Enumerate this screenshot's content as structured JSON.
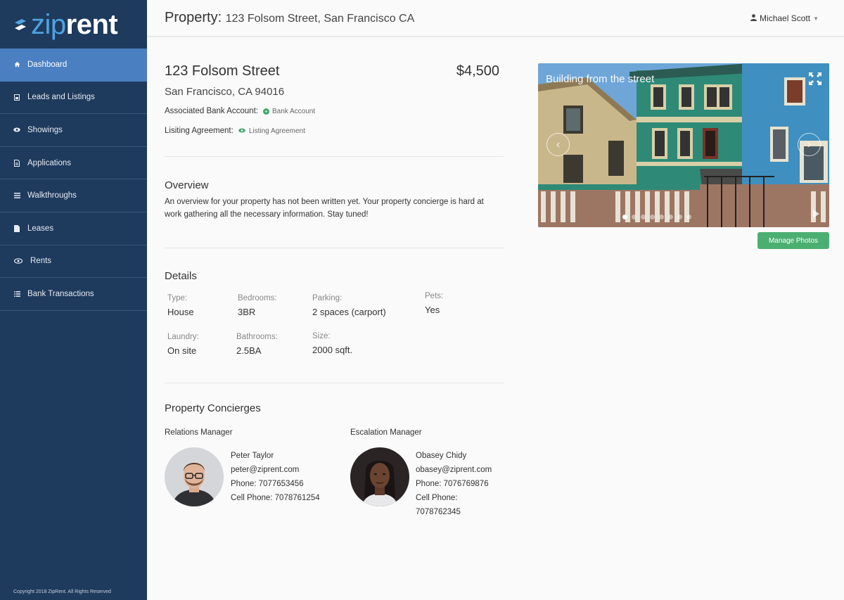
{
  "brand": {
    "zip": "zip",
    "rent": "rent"
  },
  "sidebar": {
    "items": [
      {
        "label": "Dashboard",
        "icon": "home-icon"
      },
      {
        "label": "Leads and Listings",
        "icon": "listing-icon"
      },
      {
        "label": "Showings",
        "icon": "eye-icon"
      },
      {
        "label": "Applications",
        "icon": "document-icon"
      },
      {
        "label": "Walkthroughs",
        "icon": "list-icon"
      },
      {
        "label": "Leases",
        "icon": "file-icon"
      },
      {
        "label": "Rents",
        "icon": "money-icon"
      },
      {
        "label": "Bank Transactions",
        "icon": "list-icon"
      }
    ],
    "copyright": "Copyright 2018 ZipRent. All Rights Reserved"
  },
  "header": {
    "title": "Property:",
    "address": "123 Folsom Street, San Francisco CA",
    "user": "Michael Scott"
  },
  "property": {
    "name": "123 Folsom Street",
    "price": "$4,500",
    "city": "San Francisco, CA 94016",
    "bank_label": "Associated Bank Account:",
    "bank_value": "Bank Account",
    "agreement_label": "Lisiting Agreement:",
    "agreement_value": "Listing Agreement"
  },
  "overview": {
    "title": "Overview",
    "text": "An overview for your property has not been written yet. Your property concierge is hard at work gathering all the necessary information. Stay tuned!"
  },
  "details": {
    "title": "Details",
    "type_label": "Type:",
    "type": "House",
    "bedrooms_label": "Bedrooms:",
    "bedrooms": "3BR",
    "parking_label": "Parking:",
    "parking": "2 spaces (carport)",
    "pets_label": "Pets:",
    "pets": "Yes",
    "laundry_label": "Laundry:",
    "laundry": "On site",
    "bathrooms_label": "Bathrooms:",
    "bathrooms": "2.5BA",
    "size_label": "Size:",
    "size": "2000 sqft."
  },
  "concierges": {
    "title": "Property Concierges",
    "relations": {
      "role": "Relations Manager",
      "name": "Peter Taylor",
      "email": "peter@ziprent.com",
      "phone": "Phone: 7077653456",
      "cell": "Cell Phone: 7078761254"
    },
    "escalation": {
      "role": "Escalation Manager",
      "name": "Obasey Chidy",
      "email": "obasey@ziprent.com",
      "phone": "Phone: 7076769876",
      "cell": "Cell Phone: 7078762345"
    }
  },
  "photo": {
    "caption": "Building from the street",
    "manage_label": "Manage Photos"
  },
  "colors": {
    "sidebar": "#1e3a5c",
    "active": "#4a7fc1",
    "accent_green": "#4caf72"
  }
}
